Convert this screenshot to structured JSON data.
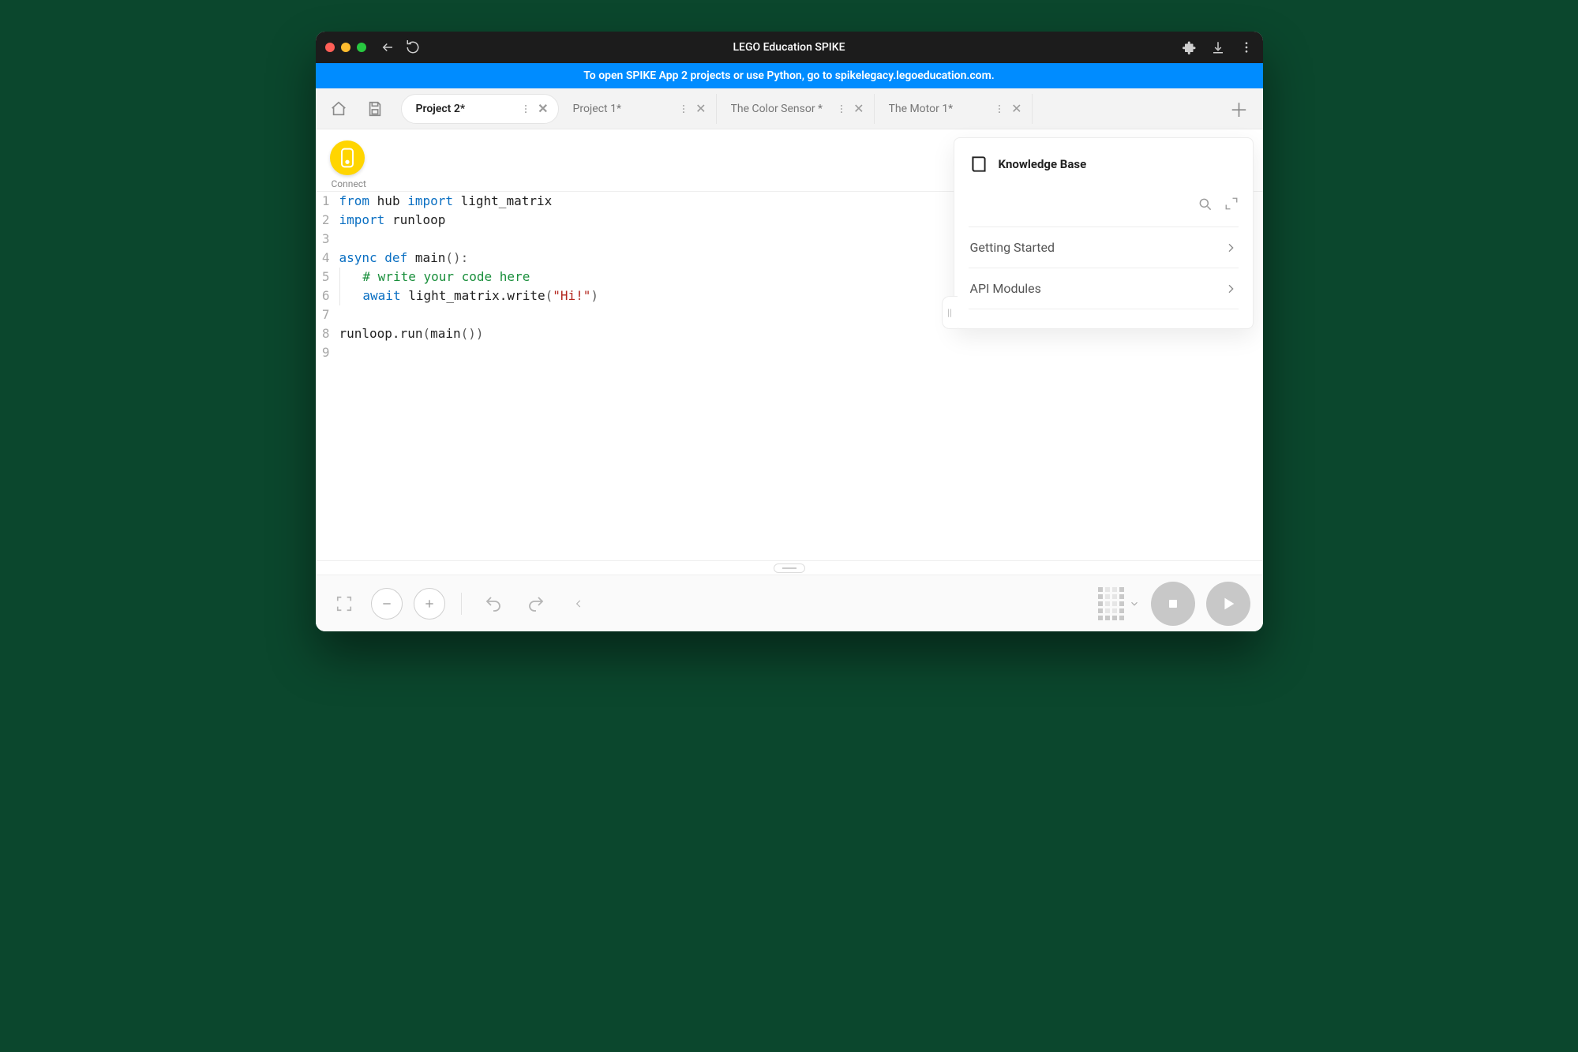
{
  "title": "LEGO Education SPIKE",
  "banner": "To open SPIKE App 2 projects or use Python, go to spikelegacy.legoeducation.com.",
  "tabs": [
    {
      "label": "Project 2*",
      "active": true
    },
    {
      "label": "Project 1*",
      "active": false
    },
    {
      "label": "The Color Sensor *",
      "active": false
    },
    {
      "label": "The Motor 1*",
      "active": false
    }
  ],
  "connect_label": "Connect",
  "code": {
    "lines": [
      {
        "n": 1,
        "segments": [
          {
            "t": "from ",
            "c": "tok-kw"
          },
          {
            "t": "hub ",
            "c": ""
          },
          {
            "t": "import ",
            "c": "tok-kw"
          },
          {
            "t": "light_matrix",
            "c": ""
          }
        ]
      },
      {
        "n": 2,
        "segments": [
          {
            "t": "import ",
            "c": "tok-kw"
          },
          {
            "t": "runloop",
            "c": ""
          }
        ]
      },
      {
        "n": 3,
        "segments": []
      },
      {
        "n": 4,
        "segments": [
          {
            "t": "async def ",
            "c": "tok-kw"
          },
          {
            "t": "main",
            "c": ""
          },
          {
            "t": "():",
            "c": "tok-pn"
          }
        ]
      },
      {
        "n": 5,
        "indent": 1,
        "segments": [
          {
            "t": "# write your code here",
            "c": "tok-cm"
          }
        ]
      },
      {
        "n": 6,
        "indent": 1,
        "segments": [
          {
            "t": "await ",
            "c": "tok-kw"
          },
          {
            "t": "light_matrix.write",
            "c": ""
          },
          {
            "t": "(",
            "c": "tok-pn"
          },
          {
            "t": "\"Hi!\"",
            "c": "tok-str"
          },
          {
            "t": ")",
            "c": "tok-pn"
          }
        ]
      },
      {
        "n": 7,
        "segments": []
      },
      {
        "n": 8,
        "segments": [
          {
            "t": "runloop.run",
            "c": ""
          },
          {
            "t": "(",
            "c": "tok-pn"
          },
          {
            "t": "main",
            "c": ""
          },
          {
            "t": "())",
            "c": "tok-pn"
          }
        ]
      },
      {
        "n": 9,
        "segments": []
      }
    ]
  },
  "kb": {
    "title": "Knowledge Base",
    "items": [
      {
        "label": "Getting Started"
      },
      {
        "label": "API Modules"
      }
    ]
  }
}
